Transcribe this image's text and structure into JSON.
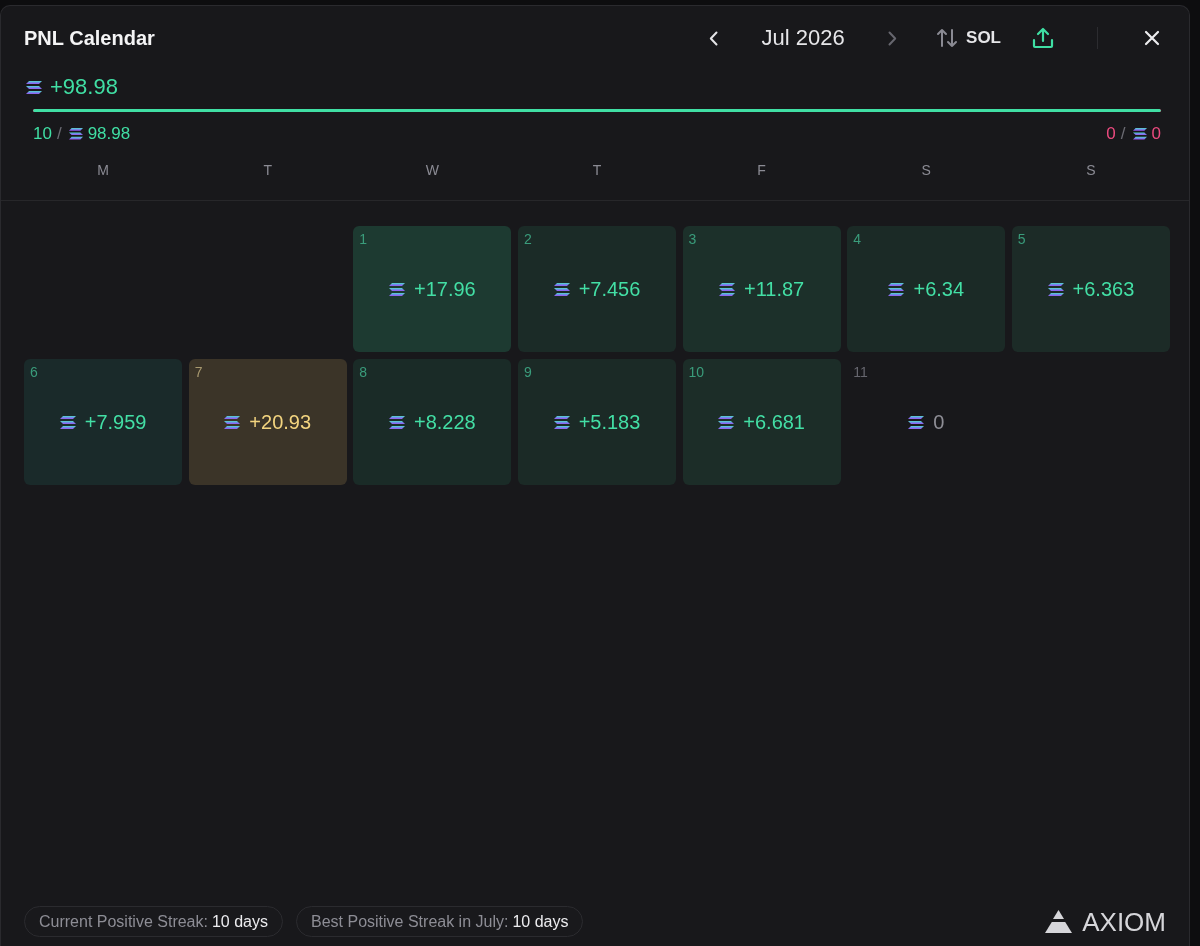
{
  "window": {
    "title": "PNL Calendar"
  },
  "header": {
    "prev_button": {
      "disabled": false
    },
    "month": "Jul 2026",
    "next_button": {
      "disabled": true
    },
    "currency_toggle": {
      "label": "SOL"
    }
  },
  "summary": {
    "total": "+98.98",
    "balance_bar": {
      "level": 1
    },
    "gains": {
      "count": "10",
      "separator": "/",
      "amount": "98.98"
    },
    "losses": {
      "count": "0",
      "separator": "/",
      "amount": "0"
    }
  },
  "weekdays": [
    "M",
    "T",
    "W",
    "T",
    "F",
    "S",
    "S"
  ],
  "weeks": [
    {
      "days": [
        {
          "kind": "blank"
        },
        {
          "kind": "blank"
        },
        {
          "day": "1",
          "value": "+17.96",
          "kind": "gain",
          "color": "#1d3a31"
        },
        {
          "day": "2",
          "value": "+7.456",
          "kind": "gain",
          "color": "#1b2b27"
        },
        {
          "day": "3",
          "value": "+11.87",
          "kind": "gain",
          "color": "#1c302a"
        },
        {
          "day": "4",
          "value": "+6.34",
          "kind": "gain",
          "color": "#1b2a26"
        },
        {
          "day": "5",
          "value": "+6.363",
          "kind": "gain",
          "color": "#1c2b27"
        }
      ]
    },
    {
      "days": [
        {
          "day": "6",
          "value": "+7.959",
          "kind": "gain",
          "color": "#1a2a2a"
        },
        {
          "day": "7",
          "value": "+20.93",
          "kind": "best",
          "color": "#3b3428"
        },
        {
          "day": "8",
          "value": "+8.228",
          "kind": "gain",
          "color": "#1a2b27"
        },
        {
          "day": "9",
          "value": "+5.183",
          "kind": "gain",
          "color": "#1b2a26"
        },
        {
          "day": "10",
          "value": "+6.681",
          "kind": "gain",
          "color": "#1c2d28"
        },
        {
          "day": "11",
          "value": "0",
          "kind": "flat"
        }
      ]
    }
  ],
  "footer": {
    "streaks": [
      {
        "label": "Current Positive Streak:",
        "value": "10 days"
      },
      {
        "label": "Best Positive Streak in July:",
        "value": "10 days"
      }
    ],
    "brand": {
      "name": "AXIOM"
    }
  }
}
